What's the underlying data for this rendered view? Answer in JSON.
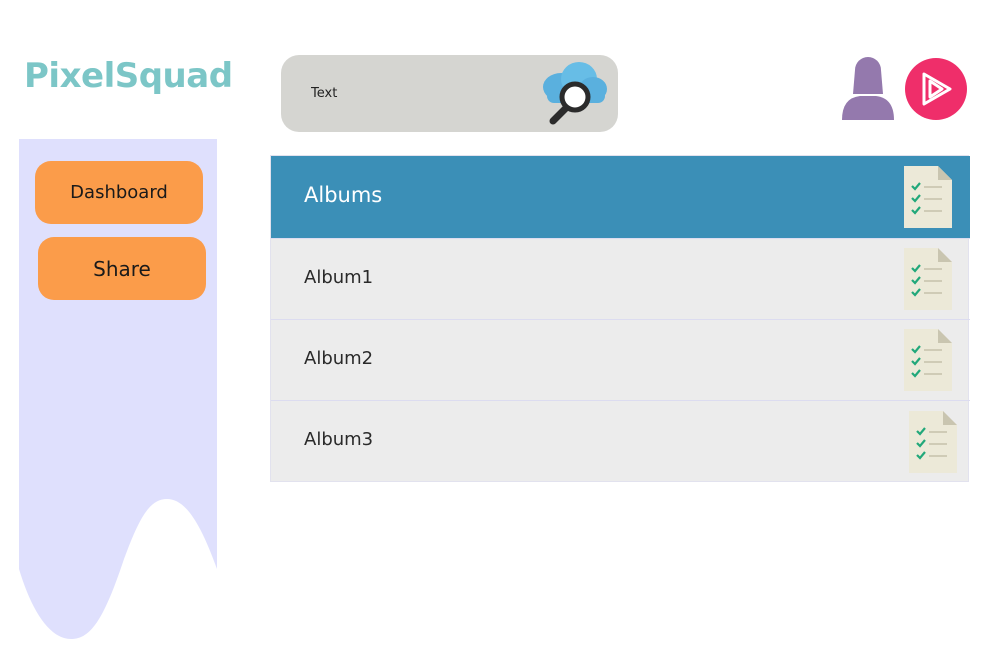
{
  "app": {
    "logo": "PixelSquad"
  },
  "search": {
    "value": "Text",
    "icon": "cloud-search-icon"
  },
  "header_icons": {
    "user": "user-icon",
    "play": "play-icon",
    "play_color": "#ef2e6a"
  },
  "sidebar": {
    "background": "#dfe0fd",
    "items": [
      {
        "label": "Dashboard"
      },
      {
        "label": "Share"
      }
    ]
  },
  "albums": {
    "header": "Albums",
    "header_color": "#3b8fb7",
    "items": [
      {
        "label": "Album1"
      },
      {
        "label": "Album2"
      },
      {
        "label": "Album3"
      }
    ],
    "row_icon": "checklist-document-icon"
  },
  "colors": {
    "logo": "#7cc6c7",
    "button": "#fb9c4a"
  }
}
